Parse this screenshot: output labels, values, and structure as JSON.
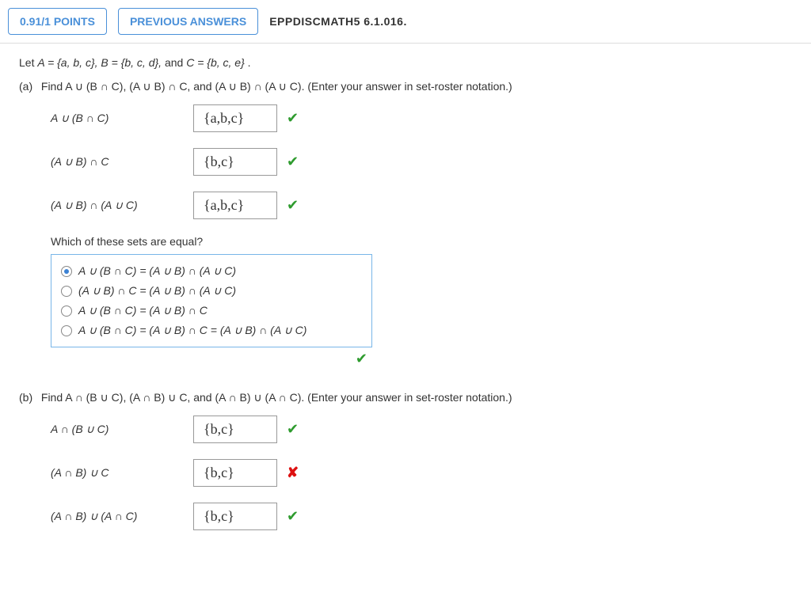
{
  "header": {
    "points": "0.91/1 POINTS",
    "previous": "PREVIOUS ANSWERS",
    "question_id": "EPPDISCMATH5 6.1.016."
  },
  "prompt": {
    "sets_line_prefix": "Let ",
    "sets_line_ital": "A = {a, b, c}, B = {b, c, d}, ",
    "sets_line_mid": "and ",
    "sets_line_ital2": "C = {b, c, e}",
    "period": "."
  },
  "part_a": {
    "label": "(a)",
    "instruction": "Find A ∪ (B ∩ C), (A ∪ B) ∩ C, and (A ∪ B) ∩ (A ∪ C). (Enter your answer in set-roster notation.)",
    "rows": [
      {
        "expr": "A ∪ (B ∩ C)",
        "ans": "{a,b,c}",
        "result": "check"
      },
      {
        "expr": "(A ∪ B) ∩ C",
        "ans": "{b,c}",
        "result": "check"
      },
      {
        "expr": "(A ∪ B) ∩ (A ∪ C)",
        "ans": "{a,b,c}",
        "result": "check"
      }
    ],
    "subq": "Which of these sets are equal?",
    "options": [
      {
        "text": "A ∪ (B ∩ C) = (A ∪ B) ∩ (A ∪ C)",
        "selected": true
      },
      {
        "text": "(A ∪ B) ∩ C = (A ∪ B) ∩ (A ∪ C)",
        "selected": false
      },
      {
        "text": "A ∪ (B ∩ C) = (A ∪ B) ∩ C",
        "selected": false
      },
      {
        "text": "A ∪ (B ∩ C) = (A ∪ B) ∩ C = (A ∪ B) ∩ (A ∪ C)",
        "selected": false
      }
    ],
    "mc_result": "check"
  },
  "part_b": {
    "label": "(b)",
    "instruction": "Find A ∩ (B ∪ C), (A ∩ B) ∪ C, and (A ∩ B) ∪ (A ∩ C). (Enter your answer in set-roster notation.)",
    "rows": [
      {
        "expr": "A ∩ (B ∪ C)",
        "ans": "{b,c}",
        "result": "check"
      },
      {
        "expr": "(A ∩ B) ∪ C",
        "ans": "{b,c}",
        "result": "cross"
      },
      {
        "expr": "(A ∩ B) ∪ (A ∩ C)",
        "ans": "{b,c}",
        "result": "check"
      }
    ]
  }
}
